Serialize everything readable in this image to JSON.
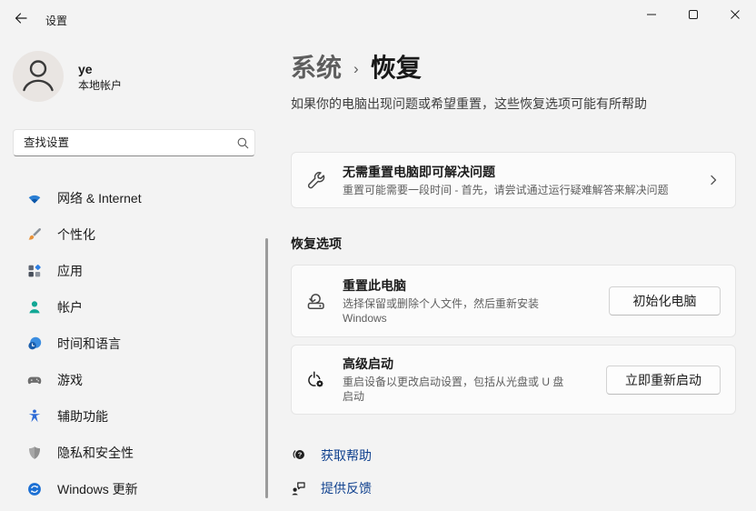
{
  "titlebar": {
    "title": "设置"
  },
  "window_controls": {
    "minimize_icon": "minimize-icon",
    "maximize_icon": "maximize-icon",
    "close_icon": "close-icon"
  },
  "user": {
    "name": "ye",
    "account_type": "本地帐户",
    "avatar_icon": "person-outline-icon"
  },
  "search": {
    "placeholder": "查找设置",
    "icon": "search-icon"
  },
  "sidebar": {
    "items": [
      {
        "label": "网络 & Internet",
        "icon": "wifi-icon"
      },
      {
        "label": "个性化",
        "icon": "paintbrush-icon"
      },
      {
        "label": "应用",
        "icon": "apps-icon"
      },
      {
        "label": "帐户",
        "icon": "person-icon"
      },
      {
        "label": "时间和语言",
        "icon": "clock-globe-icon"
      },
      {
        "label": "游戏",
        "icon": "gamepad-icon"
      },
      {
        "label": "辅助功能",
        "icon": "accessibility-icon"
      },
      {
        "label": "隐私和安全性",
        "icon": "shield-icon"
      },
      {
        "label": "Windows 更新",
        "icon": "update-icon"
      }
    ]
  },
  "breadcrumb": {
    "parent": "系统",
    "separator": "›",
    "current": "恢复"
  },
  "page": {
    "description": "如果你的电脑出现问题或希望重置，这些恢复选项可能有所帮助"
  },
  "troubleshoot_card": {
    "icon": "wrench-icon",
    "title": "无需重置电脑即可解决问题",
    "description": "重置可能需要一段时间 - 首先，请尝试通过运行疑难解答来解决问题",
    "chevron_icon": "chevron-right-icon"
  },
  "recovery_section": {
    "header": "恢复选项",
    "reset_card": {
      "icon": "reset-pc-icon",
      "title": "重置此电脑",
      "description": "选择保留或删除个人文件，然后重新安装 Windows",
      "button": "初始化电脑"
    },
    "advanced_card": {
      "icon": "power-gear-icon",
      "title": "高级启动",
      "description": "重启设备以更改启动设置，包括从光盘或 U 盘启动",
      "button": "立即重新启动"
    }
  },
  "footer": {
    "help": {
      "label": "获取帮助",
      "icon": "help-chat-icon"
    },
    "feedback": {
      "label": "提供反馈",
      "icon": "feedback-icon"
    }
  },
  "colors": {
    "background": "#f3f3f3",
    "card_background": "#fbfbfb",
    "card_border": "#e5e5e5",
    "link": "#11428f",
    "secondary_text": "#5f5f5f",
    "accent_blue_icon": "#2b7fd4",
    "teal_icon": "#11a795"
  }
}
